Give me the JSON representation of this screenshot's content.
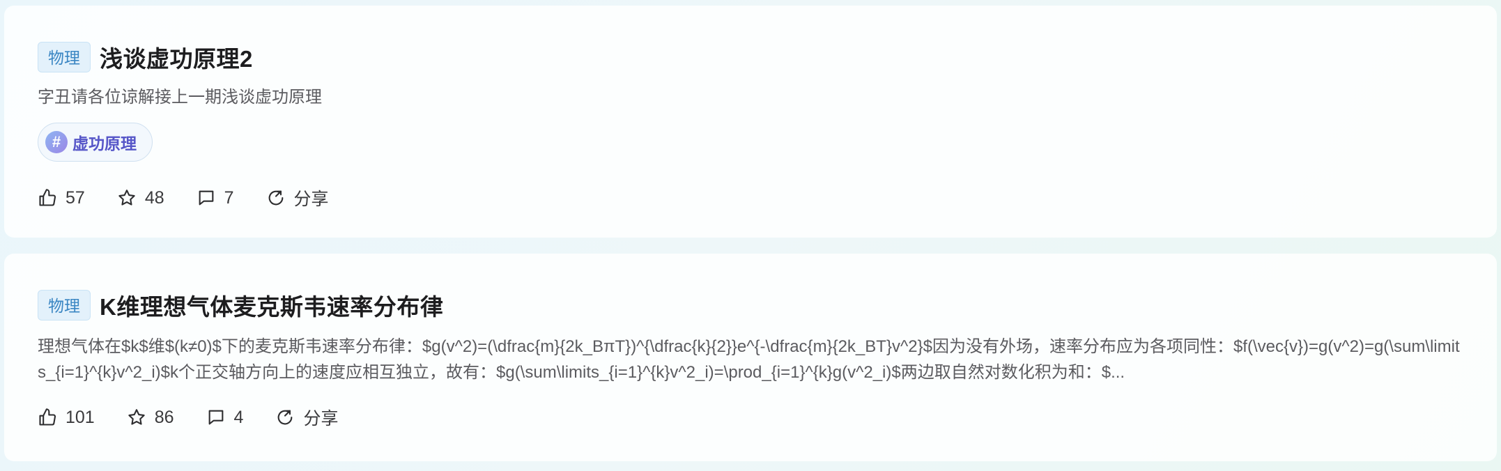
{
  "posts": [
    {
      "category": "物理",
      "title": "浅谈虚功原理2",
      "excerpt": "字丑请各位谅解接上一期浅谈虚功原理",
      "tags": [
        "虚功原理"
      ],
      "hash_symbol": "#",
      "stats": {
        "likes": "57",
        "favorites": "48",
        "comments": "7",
        "share_label": "分享"
      }
    },
    {
      "category": "物理",
      "title": "K维理想气体麦克斯韦速率分布律",
      "excerpt": "理想气体在$k$维$(k≠0)$下的麦克斯韦速率分布律：$g(v^2)=(\\dfrac{m}{2k_BπT})^{\\dfrac{k}{2}}e^{-\\dfrac{m}{2k_BT}v^2}$因为没有外场，速率分布应为各项同性：$f(\\vec{v})=g(v^2)=g(\\sum\\limits_{i=1}^{k}v^2_i)$k个正交轴方向上的速度应相互独立，故有：$g(\\sum\\limits_{i=1}^{k}v^2_i)=\\prod_{i=1}^{k}g(v^2_i)$两边取自然对数化积为和：$...",
      "stats": {
        "likes": "101",
        "favorites": "86",
        "comments": "4",
        "share_label": "分享"
      }
    }
  ],
  "icons": {
    "like": "thumbs-up-icon",
    "favorite": "star-icon",
    "comment": "comment-icon",
    "share": "share-icon",
    "tag": "hash-icon"
  },
  "colors": {
    "badge_text": "#3a86c3",
    "badge_bg": "#e3f1fb",
    "tag_text": "#5656c8"
  }
}
